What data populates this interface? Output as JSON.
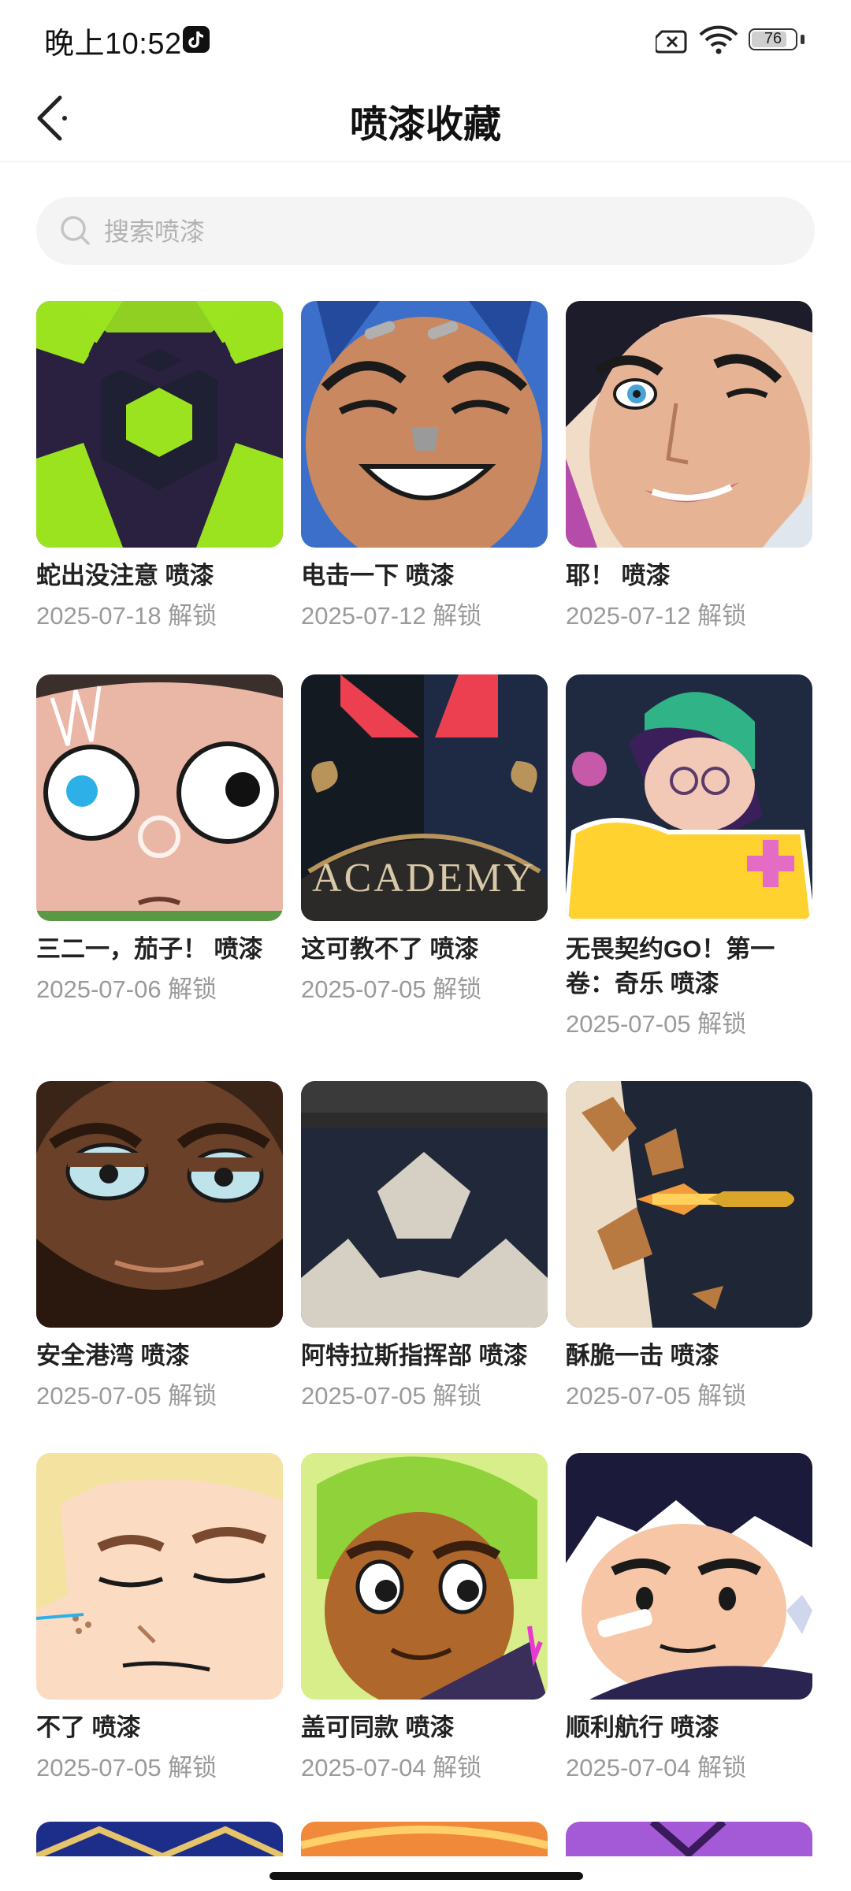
{
  "status_bar": {
    "time": "晚上10:52",
    "battery": "76"
  },
  "header": {
    "title": "喷漆收藏"
  },
  "search": {
    "placeholder": "搜索喷漆"
  },
  "items": [
    {
      "name": "蛇出没注意 喷漆",
      "date": "2025-07-18 解锁"
    },
    {
      "name": "电击一下 喷漆",
      "date": "2025-07-12 解锁"
    },
    {
      "name": "耶！ 喷漆",
      "date": "2025-07-12 解锁"
    },
    {
      "name": "三二一，茄子！ 喷漆",
      "date": "2025-07-06 解锁"
    },
    {
      "name": "这可教不了 喷漆",
      "date": "2025-07-05 解锁"
    },
    {
      "name": "无畏契约GO！第一卷：奇乐 喷漆",
      "date": "2025-07-05 解锁"
    },
    {
      "name": "安全港湾 喷漆",
      "date": "2025-07-05 解锁"
    },
    {
      "name": "阿特拉斯指挥部 喷漆",
      "date": "2025-07-05 解锁"
    },
    {
      "name": "酥脆一击 喷漆",
      "date": "2025-07-05 解锁"
    },
    {
      "name": "不了 喷漆",
      "date": "2025-07-05 解锁"
    },
    {
      "name": "盖可同款 喷漆",
      "date": "2025-07-04 解锁"
    },
    {
      "name": "顺利航行 喷漆",
      "date": "2025-07-04 解锁"
    }
  ],
  "spray_art": {
    "academy_text": "ACADEMY"
  }
}
